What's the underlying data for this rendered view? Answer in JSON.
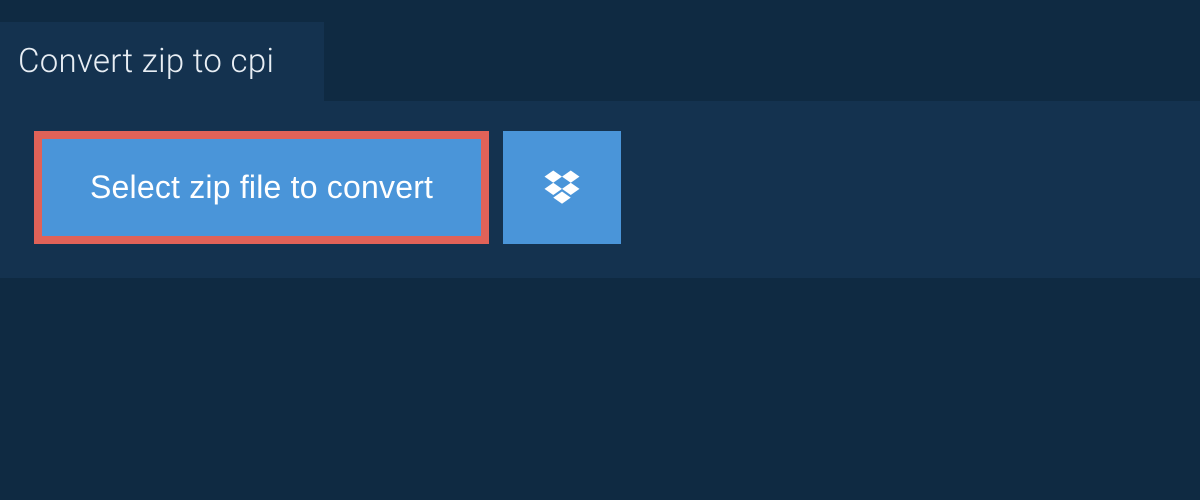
{
  "tab": {
    "title": "Convert zip to cpi"
  },
  "actions": {
    "select_file_label": "Select zip file to convert",
    "dropbox_icon_name": "dropbox-icon"
  },
  "colors": {
    "background": "#0f2a42",
    "panel": "#14324f",
    "button": "#4a95d9",
    "highlight_border": "#e06258",
    "text_light": "#e8eef4",
    "text_white": "#ffffff"
  }
}
